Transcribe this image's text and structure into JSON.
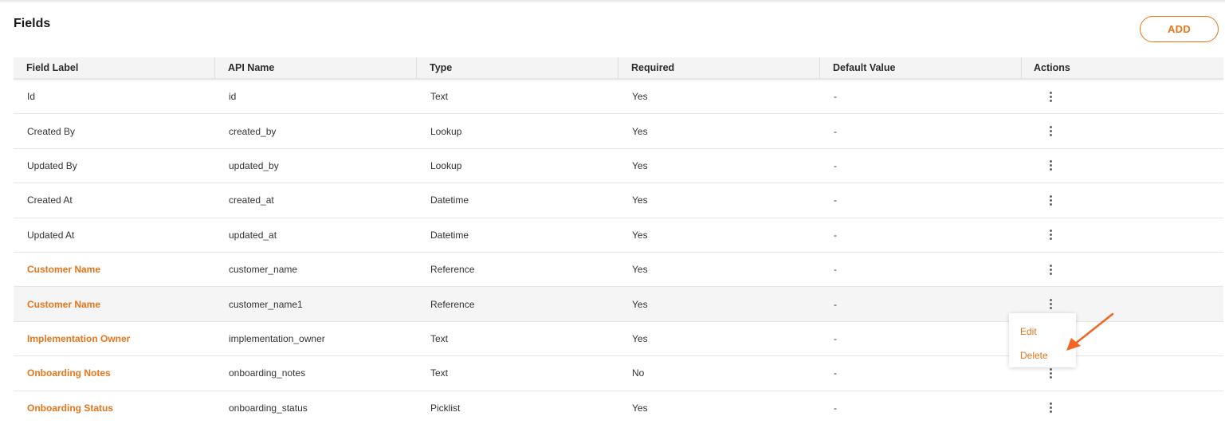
{
  "header": {
    "title": "Fields",
    "add_label": "ADD"
  },
  "table": {
    "columns": [
      "Field Label",
      "API Name",
      "Type",
      "Required",
      "Default Value",
      "Actions"
    ],
    "rows": [
      {
        "label": "Id",
        "api": "id",
        "type": "Text",
        "required": "Yes",
        "default": "-",
        "custom": false
      },
      {
        "label": "Created By",
        "api": "created_by",
        "type": "Lookup",
        "required": "Yes",
        "default": "-",
        "custom": false
      },
      {
        "label": "Updated By",
        "api": "updated_by",
        "type": "Lookup",
        "required": "Yes",
        "default": "-",
        "custom": false
      },
      {
        "label": "Created At",
        "api": "created_at",
        "type": "Datetime",
        "required": "Yes",
        "default": "-",
        "custom": false
      },
      {
        "label": "Updated At",
        "api": "updated_at",
        "type": "Datetime",
        "required": "Yes",
        "default": "-",
        "custom": false
      },
      {
        "label": "Customer Name",
        "api": "customer_name",
        "type": "Reference",
        "required": "Yes",
        "default": "-",
        "custom": true
      },
      {
        "label": "Customer Name",
        "api": "customer_name1",
        "type": "Reference",
        "required": "Yes",
        "default": "-",
        "custom": true
      },
      {
        "label": "Implementation Owner",
        "api": "implementation_owner",
        "type": "Text",
        "required": "Yes",
        "default": "-",
        "custom": true
      },
      {
        "label": "Onboarding Notes",
        "api": "onboarding_notes",
        "type": "Text",
        "required": "No",
        "default": "-",
        "custom": true
      },
      {
        "label": "Onboarding Status",
        "api": "onboarding_status",
        "type": "Picklist",
        "required": "Yes",
        "default": "-",
        "custom": true
      }
    ]
  },
  "actions_menu": {
    "items": [
      "Edit",
      "Delete"
    ]
  },
  "colors": {
    "accent": "#e8751a",
    "annotation_arrow": "#f26522"
  }
}
